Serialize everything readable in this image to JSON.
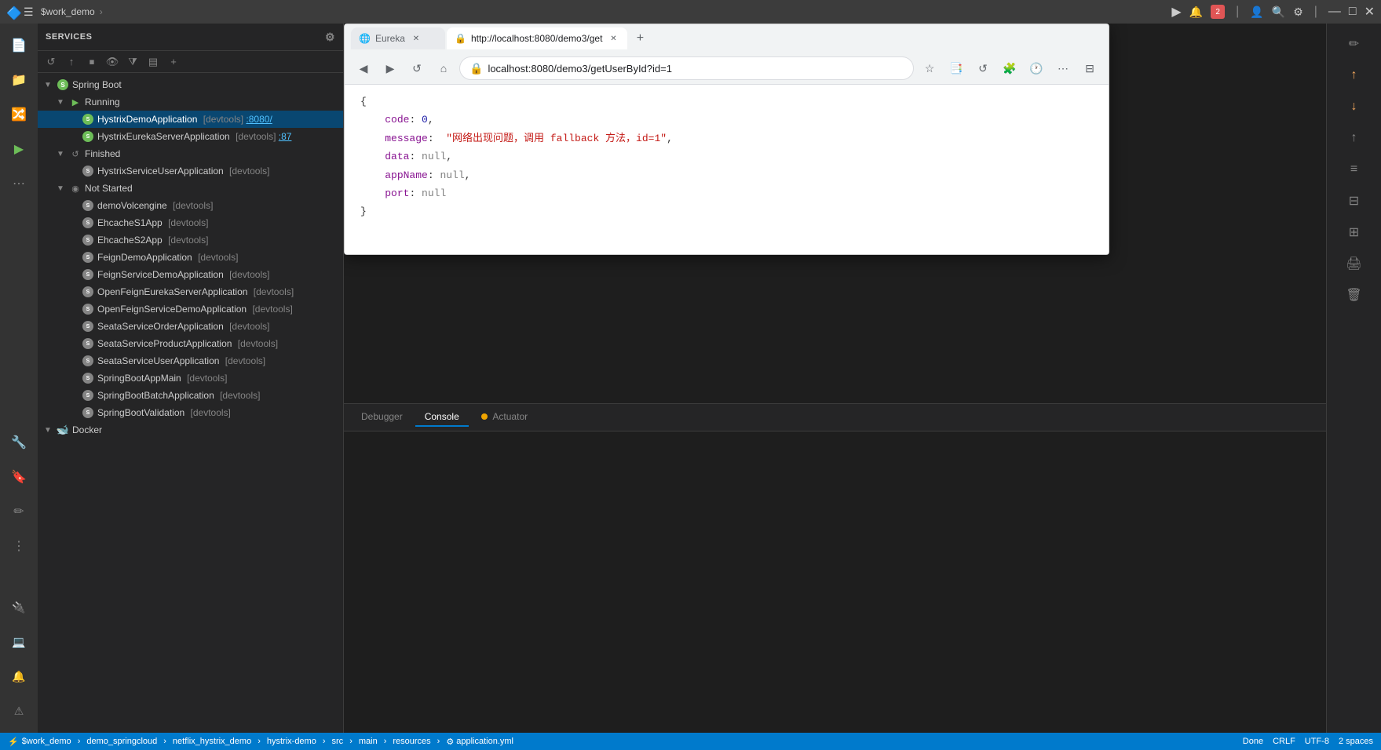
{
  "topbar": {
    "project_label": "$work_demo",
    "icons": {
      "hamburger": "☰",
      "run": "▶",
      "notification": "🔔",
      "search": "🔍",
      "settings": "⚙",
      "minimize": "—",
      "maximize": "□",
      "close": "✕"
    }
  },
  "browser": {
    "tabs": [
      {
        "label": "Eureka",
        "active": false,
        "favicon": "🌐"
      },
      {
        "label": "http://localhost:8080/demo3/get",
        "active": true,
        "favicon": "🔒"
      }
    ],
    "url": "localhost:8080/demo3/getUserById?id=1",
    "json_response": {
      "code": 0,
      "message": "\"网络出现问题，调用 fallback 方法，id=1\"",
      "data": "null",
      "appName": "null",
      "port": "null"
    }
  },
  "services": {
    "header": "Services",
    "sections": {
      "spring_boot": {
        "label": "Spring Boot",
        "running": {
          "label": "Running",
          "apps": [
            {
              "name": "HystrixDemoApplication",
              "tag": "[devtools]",
              "port": ":8080/",
              "selected": true
            },
            {
              "name": "HystrixEurekaServerApplication",
              "tag": "[devtools]",
              "port": ":87"
            }
          ]
        },
        "finished": {
          "label": "Finished",
          "apps": [
            {
              "name": "HystrixServiceUserApplication",
              "tag": "[devtools]"
            }
          ]
        },
        "not_started": {
          "label": "Not Started",
          "apps": [
            {
              "name": "demoVolcengine",
              "tag": "[devtools]"
            },
            {
              "name": "EhcacheS1App",
              "tag": "[devtools]"
            },
            {
              "name": "EhcacheS2App",
              "tag": "[devtools]"
            },
            {
              "name": "FeignDemoApplication",
              "tag": "[devtools]"
            },
            {
              "name": "FeignServiceDemoApplication",
              "tag": "[devtools]"
            },
            {
              "name": "OpenFeignEurekaServerApplication",
              "tag": "[devtools]"
            },
            {
              "name": "OpenFeignServiceDemoApplication",
              "tag": "[devtools]"
            },
            {
              "name": "SeataServiceOrderApplication",
              "tag": "[devtools]"
            },
            {
              "name": "SeataServiceProductApplication",
              "tag": "[devtools]"
            },
            {
              "name": "SeataServiceUserApplication",
              "tag": "[devtools]"
            },
            {
              "name": "SpringBootAppMain",
              "tag": "[devtools]"
            },
            {
              "name": "SpringBootBatchApplication",
              "tag": "[devtools]"
            },
            {
              "name": "SpringBootValidation",
              "tag": "[devtools]"
            }
          ]
        }
      },
      "docker": {
        "label": "Docker"
      }
    }
  },
  "bottom_panel": {
    "tabs": [
      "Debugger",
      "Console",
      "Actuator"
    ]
  },
  "status_bar": {
    "left": [
      "⚡ $work_demo",
      "demo_springcloud",
      "netflix_hystrix_demo",
      "hystrix-demo",
      "src",
      "main",
      "resources",
      "⚙ application.yml"
    ],
    "right": {
      "done": "Done",
      "line_ending": "CRLF",
      "encoding": "UTF-8",
      "indent": "2 spaces"
    }
  },
  "toolbar_icons": {
    "refresh": "↺",
    "stop": "⏹",
    "visibility": "👁",
    "filter": "⧩",
    "group": "▤",
    "add": "+"
  }
}
